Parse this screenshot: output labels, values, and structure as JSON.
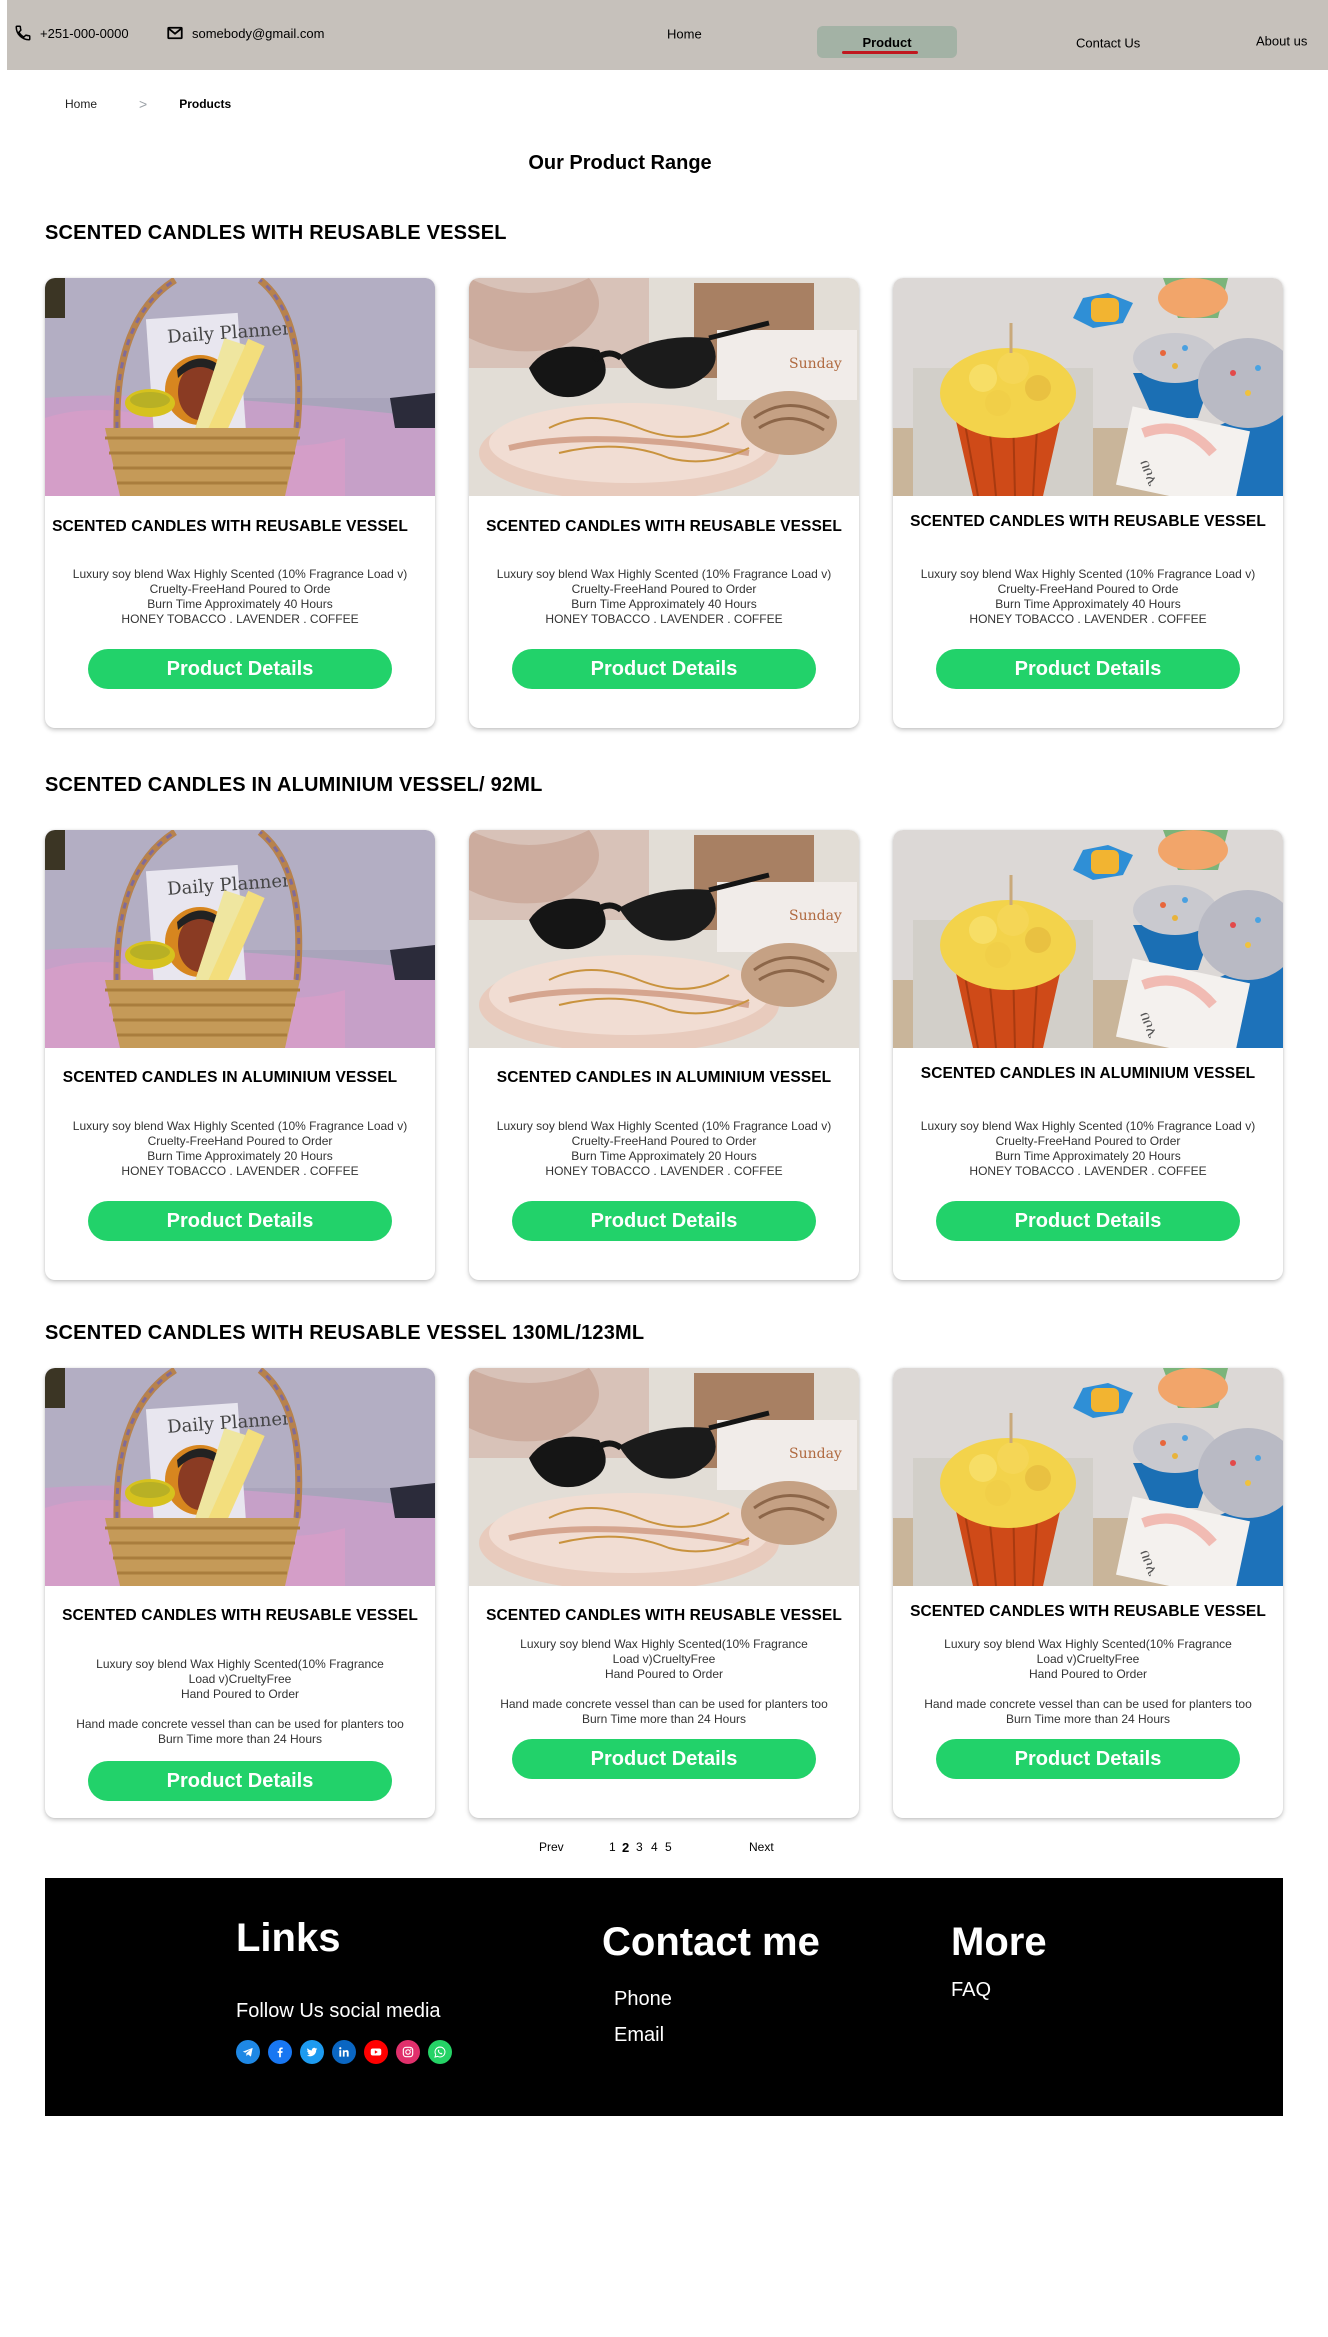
{
  "topbar": {
    "phone": "+251-000-0000",
    "email": "somebody@gmail.com",
    "nav": {
      "home": "Home",
      "product": "Product",
      "contact": "Contact Us",
      "about": "About us"
    },
    "background": "#c6c1bb",
    "active_background": "#a3b2a5",
    "active_underline": "#c0191f"
  },
  "breadcrumb": {
    "home": "Home",
    "separator": ">",
    "current": "Products"
  },
  "page_title": "Our Product Range",
  "sections": [
    {
      "title": "SCENTED CANDLES WITH REUSABLE VESSEL",
      "cards": [
        {
          "image": "planner-basket-photo",
          "title": "SCENTED CANDLES WITH REUSABLE VESSEL",
          "desc": [
            "Luxury soy blend Wax Highly Scented (10% Fragrance Load v)",
            "Cruelty-FreeHand Poured to Orde",
            "Burn Time Approximately 40 Hours",
            "HONEY TOBACCO . LAVENDER . COFFEE"
          ],
          "button": "Product Details"
        },
        {
          "image": "sunglasses-tray-photo",
          "title": "SCENTED CANDLES WITH REUSABLE VESSEL",
          "desc": [
            "Luxury soy blend Wax Highly Scented (10% Fragrance Load v)",
            "Cruelty-FreeHand Poured to Order",
            "Burn Time Approximately 40 Hours",
            "HONEY TOBACCO . LAVENDER . COFFEE"
          ],
          "button": "Product Details"
        },
        {
          "image": "cupcake-candles-photo",
          "title": "SCENTED CANDLES WITH REUSABLE VESSEL",
          "desc": [
            "Luxury soy blend Wax Highly Scented (10% Fragrance Load v)",
            "Cruelty-FreeHand Poured to Orde",
            "Burn Time Approximately 40 Hours",
            "HONEY TOBACCO . LAVENDER . COFFEE"
          ],
          "button": "Product Details"
        }
      ]
    },
    {
      "title": "SCENTED CANDLES IN ALUMINIUM VESSEL/ 92ML",
      "cards": [
        {
          "image": "planner-basket-photo",
          "title": "SCENTED CANDLES IN ALUMINIUM VESSEL",
          "desc": [
            "Luxury soy blend Wax Highly Scented (10% Fragrance Load v)",
            "Cruelty-FreeHand Poured to Order",
            "Burn Time Approximately 20 Hours",
            "HONEY TOBACCO . LAVENDER . COFFEE"
          ],
          "button": "Product Details"
        },
        {
          "image": "sunglasses-tray-photo",
          "title": "SCENTED CANDLES IN ALUMINIUM VESSEL",
          "desc": [
            "Luxury soy blend Wax Highly Scented (10% Fragrance Load v)",
            "Cruelty-FreeHand Poured to Order",
            "Burn Time Approximately 20 Hours",
            "HONEY TOBACCO . LAVENDER . COFFEE"
          ],
          "button": "Product Details"
        },
        {
          "image": "cupcake-candles-photo",
          "title": "SCENTED CANDLES IN ALUMINIUM VESSEL",
          "desc": [
            "Luxury soy blend Wax Highly Scented (10% Fragrance Load v)",
            "Cruelty-FreeHand Poured to Order",
            "Burn Time Approximately 20 Hours",
            "HONEY TOBACCO . LAVENDER . COFFEE"
          ],
          "button": "Product Details"
        }
      ]
    },
    {
      "title": "SCENTED CANDLES WITH REUSABLE  VESSEL 130ML/123ML",
      "cards": [
        {
          "image": "planner-basket-photo",
          "title": "SCENTED CANDLES WITH REUSABLE  VESSEL",
          "desc": [
            "Luxury soy blend Wax Highly Scented(10% Fragrance",
            "Load v)CrueltyFree",
            "Hand Poured to Order",
            "",
            "Hand made concrete vessel than can be used for planters too",
            "Burn Time more than 24 Hours"
          ],
          "button": "Product Details"
        },
        {
          "image": "sunglasses-tray-photo",
          "title": "SCENTED CANDLES WITH REUSABLE  VESSEL",
          "desc": [
            "Luxury soy blend Wax Highly Scented(10% Fragrance",
            "Load v)CrueltyFree",
            "Hand Poured to Order",
            "",
            "Hand made concrete vessel than can be used for planters too",
            "Burn Time more than 24 Hours"
          ],
          "button": "Product Details"
        },
        {
          "image": "cupcake-candles-photo",
          "title": "SCENTED CANDLES WITH REUSABLE  VESSEL",
          "desc": [
            "Luxury soy blend Wax Highly Scented(10% Fragrance",
            "Load v)CrueltyFree",
            "Hand Poured to Order",
            "",
            "Hand made concrete vessel than can be used for planters too",
            "Burn Time more than 24 Hours"
          ],
          "button": "Product Details"
        }
      ]
    }
  ],
  "pagination": {
    "prev": "Prev",
    "pages": [
      "1",
      "2",
      "3",
      "4",
      "5"
    ],
    "current": "2",
    "next": "Next"
  },
  "footer": {
    "links_heading": "Links",
    "follow_text": "Follow Us social media",
    "social": [
      {
        "icon": "telegram-icon",
        "color": "#1e88e5"
      },
      {
        "icon": "facebook-icon",
        "color": "#1877f2"
      },
      {
        "icon": "twitter-icon",
        "color": "#1d9bf0"
      },
      {
        "icon": "linkedin-icon",
        "color": "#0a66c2"
      },
      {
        "icon": "youtube-icon",
        "color": "#ff0000"
      },
      {
        "icon": "instagram-icon",
        "color": "#e1306c"
      },
      {
        "icon": "whatsapp-icon",
        "color": "#25d366"
      }
    ],
    "contact_heading": "Contact me",
    "phone": "Phone",
    "email": "Email",
    "more_heading": "More",
    "faq": "FAQ"
  },
  "colors": {
    "button": "#22d26a",
    "footer_bg": "#000000"
  }
}
